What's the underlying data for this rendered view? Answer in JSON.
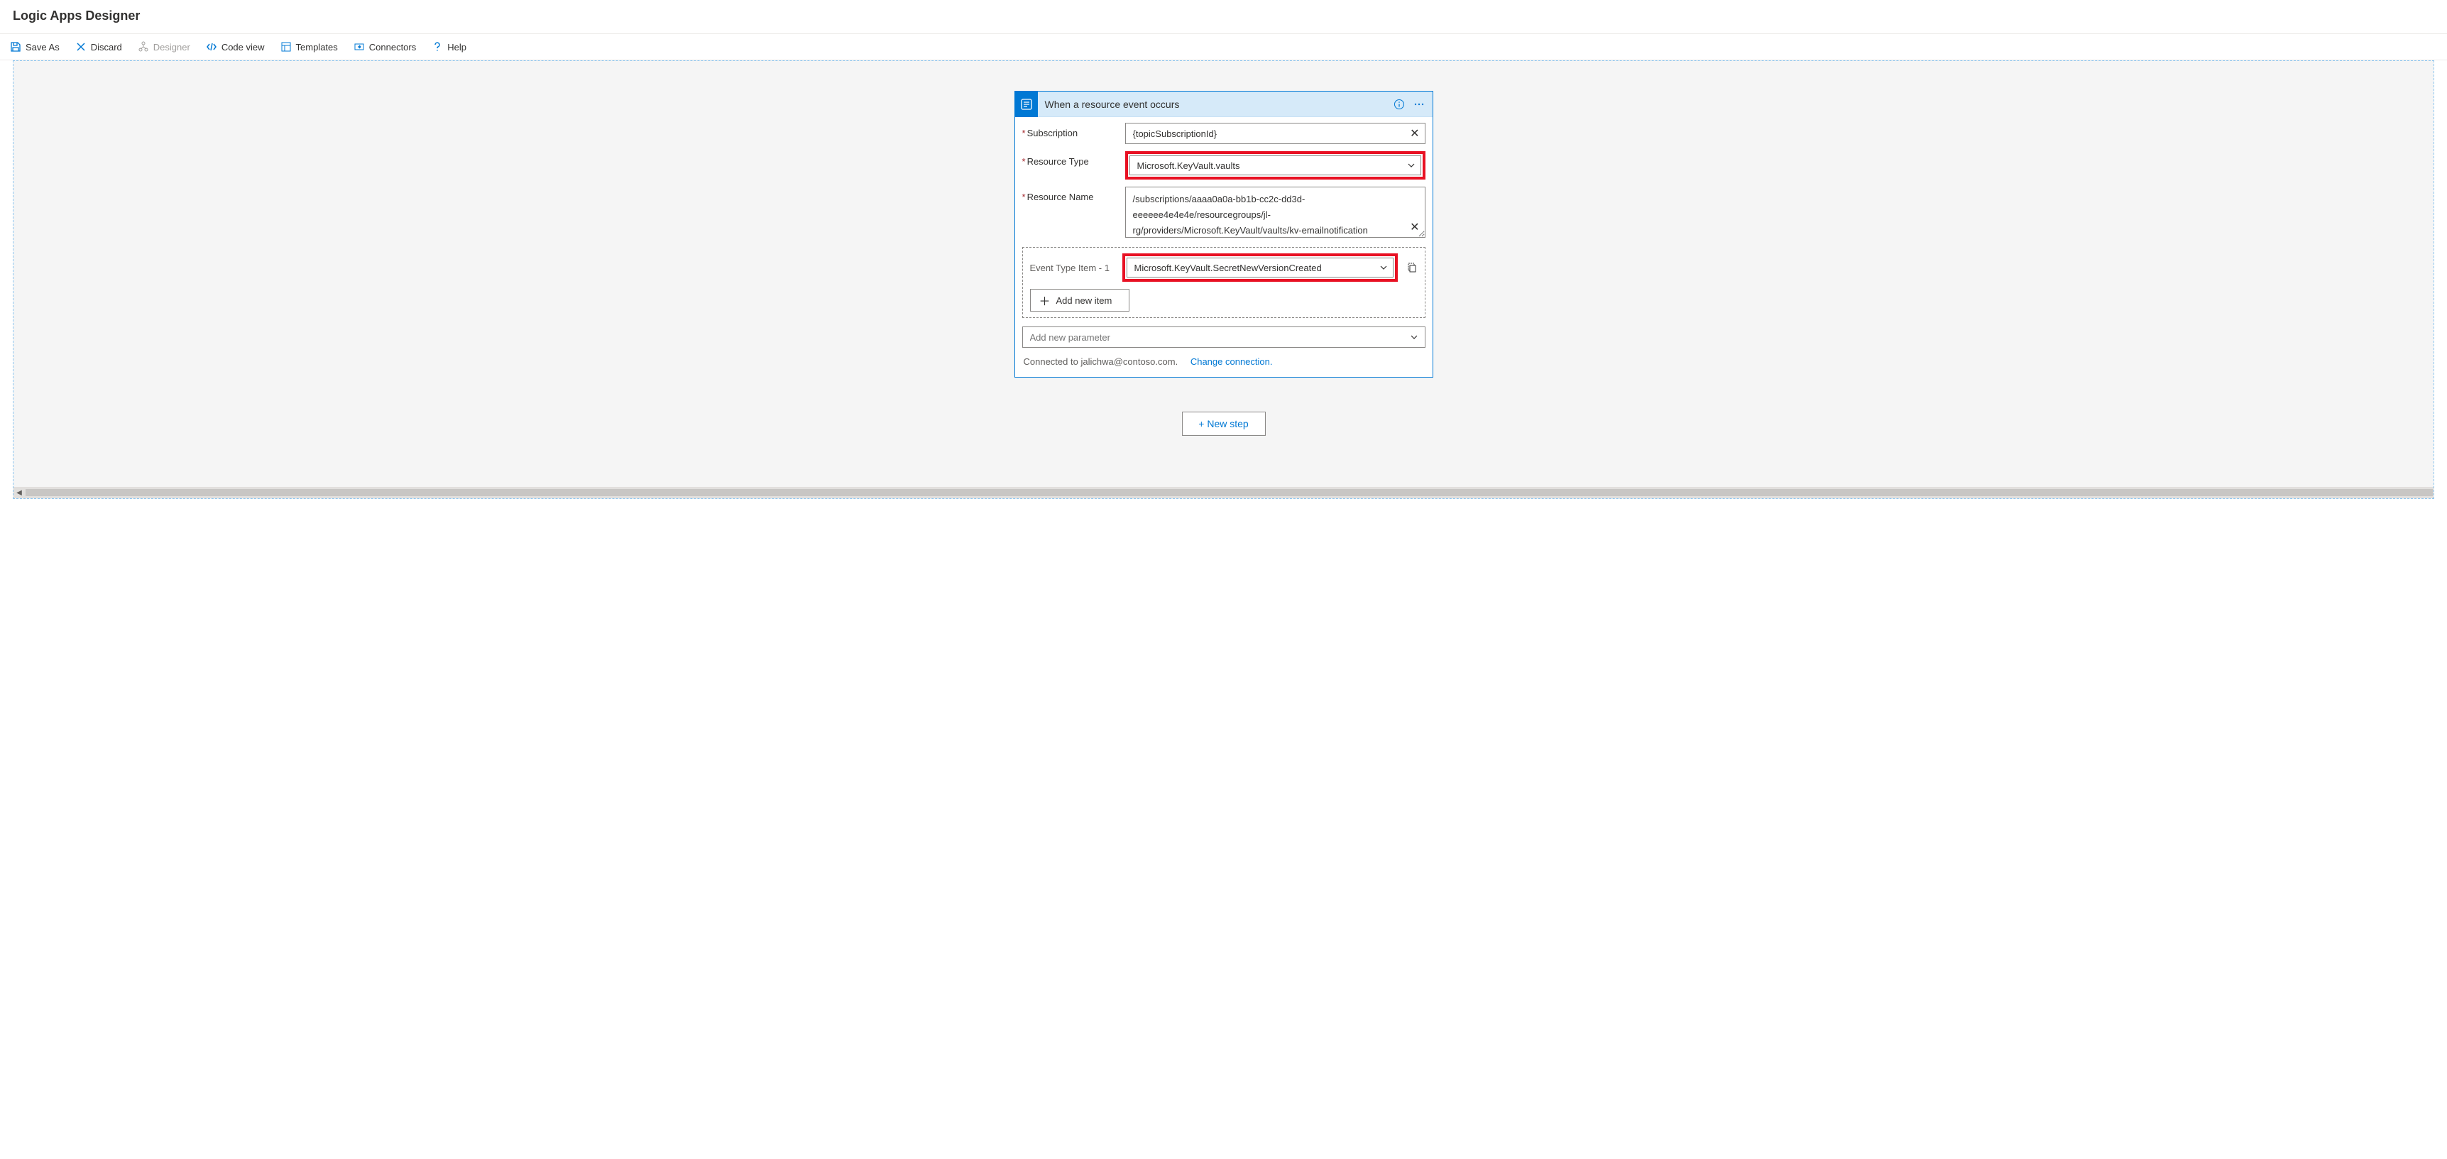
{
  "header": {
    "title": "Logic Apps Designer"
  },
  "toolbar": {
    "save_as": "Save As",
    "discard": "Discard",
    "designer": "Designer",
    "code_view": "Code view",
    "templates": "Templates",
    "connectors": "Connectors",
    "help": "Help"
  },
  "trigger": {
    "title": "When a resource event occurs",
    "fields": {
      "subscription_label": "Subscription",
      "subscription_value": "{topicSubscriptionId}",
      "resource_type_label": "Resource Type",
      "resource_type_value": "Microsoft.KeyVault.vaults",
      "resource_name_label": "Resource Name",
      "resource_name_value": "/subscriptions/aaaa0a0a-bb1b-cc2c-dd3d-eeeeee4e4e4e/resourcegroups/jl-rg/providers/Microsoft.KeyVault/vaults/kv-emailnotification"
    },
    "event_type": {
      "label": "Event Type Item - 1",
      "value": "Microsoft.KeyVault.SecretNewVersionCreated"
    },
    "add_item": "Add new item",
    "add_param_placeholder": "Add new parameter",
    "connected_to": "Connected to jalichwa@contoso.com.",
    "change_connection": "Change connection."
  },
  "new_step": "+ New step"
}
